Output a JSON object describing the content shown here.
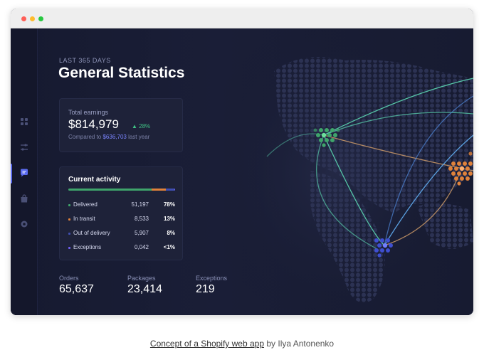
{
  "window": {
    "traffic_lights": [
      "#ff5f57",
      "#febc2e",
      "#28c840"
    ]
  },
  "sidebar": {
    "items": [
      {
        "icon": "grid-icon"
      },
      {
        "icon": "sliders-icon"
      },
      {
        "icon": "chat-icon",
        "active": true
      },
      {
        "icon": "bag-icon"
      },
      {
        "icon": "gear-icon"
      }
    ]
  },
  "header": {
    "kicker": "LAST 365 DAYS",
    "title": "General Statistics"
  },
  "earnings": {
    "label": "Total earnings",
    "value": "$814,979",
    "delta": "▲ 28%",
    "compare_prefix": "Compared to ",
    "compare_value": "$636,703",
    "compare_suffix": " last year"
  },
  "activity": {
    "title": "Current activity",
    "rows": [
      {
        "label": "Delivered",
        "count": "51,197",
        "percent": "78%",
        "color": "#3fa56b"
      },
      {
        "label": "In transit",
        "count": "8,533",
        "percent": "13%",
        "color": "#e0823b"
      },
      {
        "label": "Out of delivery",
        "count": "5,907",
        "percent": "8%",
        "color": "#3f4fb0"
      },
      {
        "label": "Exceptions",
        "count": "0,042",
        "percent": "<1%",
        "color": "#6f5df0"
      }
    ],
    "bar_segments": [
      0.78,
      0.13,
      0.08,
      0.01
    ]
  },
  "stats": [
    {
      "label": "Orders",
      "value": "65,637"
    },
    {
      "label": "Packages",
      "value": "23,414"
    },
    {
      "label": "Exceptions",
      "value": "219"
    }
  ],
  "caption": {
    "link_text": "Concept of a Shopify web app",
    "suffix": " by Ilya Antonenko"
  }
}
